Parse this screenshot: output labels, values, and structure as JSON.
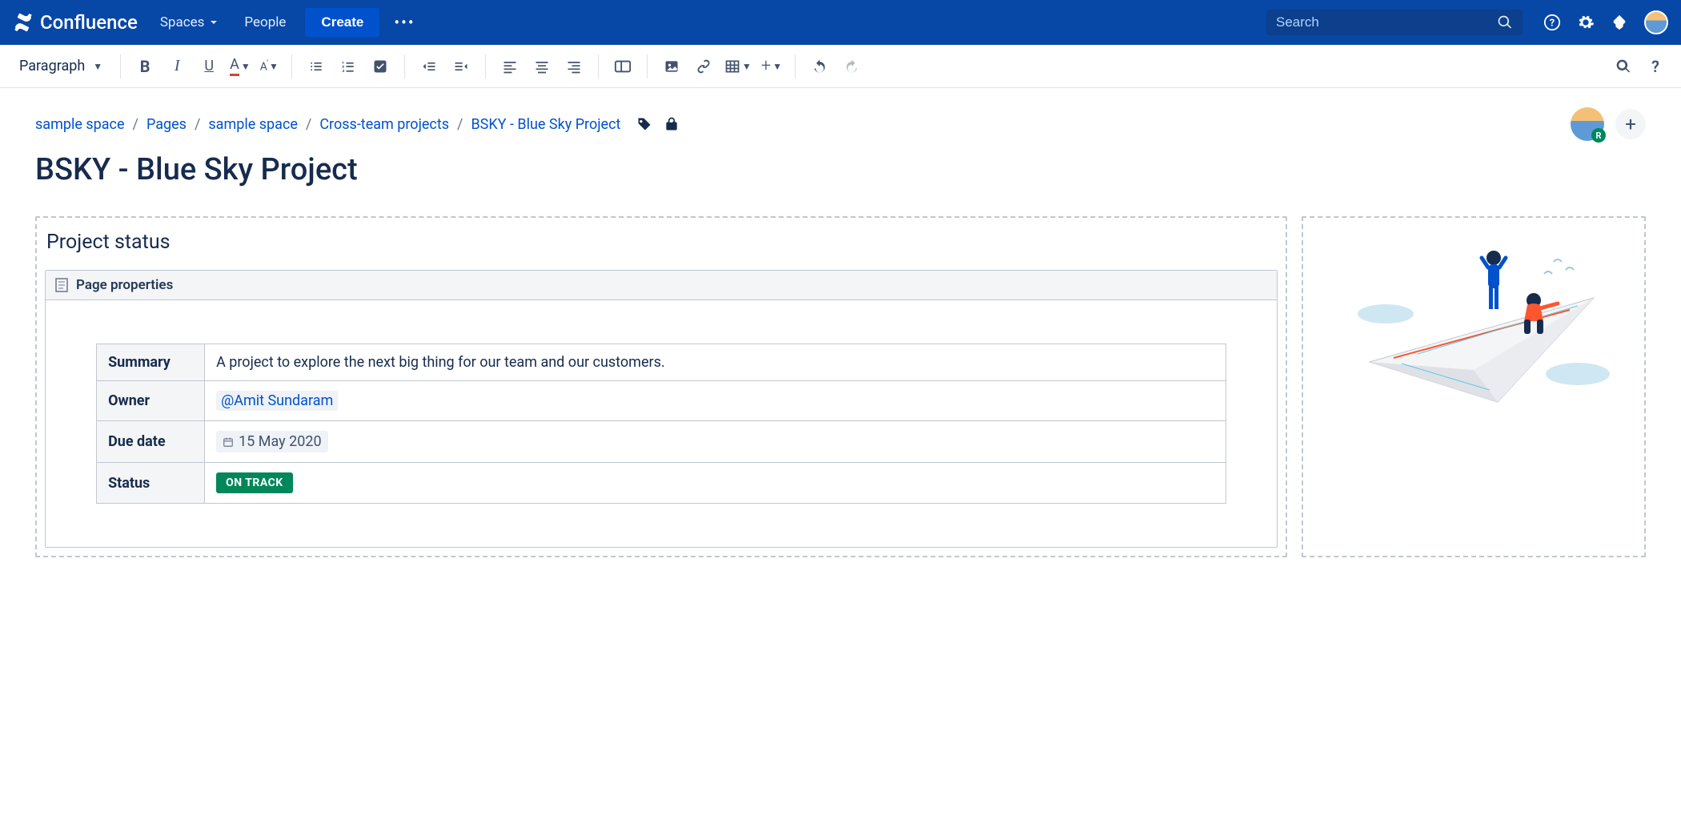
{
  "topnav": {
    "product": "Confluence",
    "spaces": "Spaces",
    "people": "People",
    "create": "Create",
    "search_placeholder": "Search"
  },
  "toolbar": {
    "style_selector": "Paragraph"
  },
  "breadcrumb": {
    "items": [
      "sample space",
      "Pages",
      "sample space",
      "Cross-team projects",
      "BSKY - Blue Sky Project"
    ]
  },
  "page": {
    "title": "BSKY - Blue Sky Project"
  },
  "status_panel": {
    "heading": "Project status",
    "macro_label": "Page properties",
    "rows": {
      "summary_label": "Summary",
      "summary_value": "A project to explore the next big thing for our team and our customers.",
      "owner_label": "Owner",
      "owner_value": "@Amit Sundaram",
      "due_label": "Due date",
      "due_value": "15 May 2020",
      "status_label": "Status",
      "status_value": "ON TRACK"
    }
  }
}
